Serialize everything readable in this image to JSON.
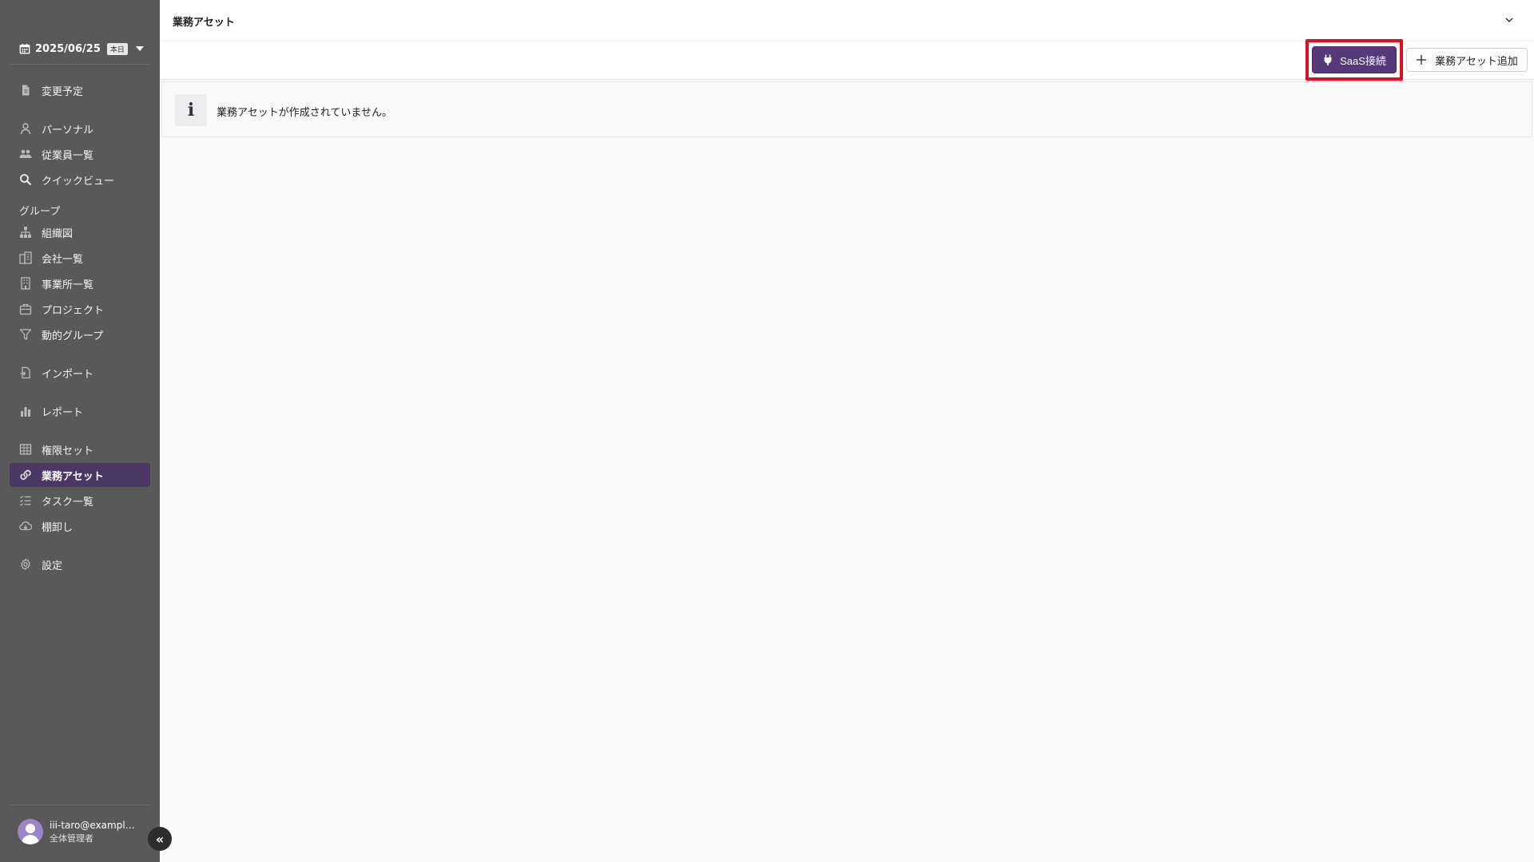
{
  "sidebar": {
    "date": "2025/06/25",
    "today_badge": "本日",
    "items": [
      {
        "label": "変更予定",
        "icon": "document-icon"
      },
      {
        "label": "パーソナル",
        "icon": "person-icon"
      },
      {
        "label": "従業員一覧",
        "icon": "people-icon"
      },
      {
        "label": "クイックビュー",
        "icon": "search-icon"
      },
      {
        "label": "組織図",
        "icon": "org-chart-icon"
      },
      {
        "label": "会社一覧",
        "icon": "buildings-icon"
      },
      {
        "label": "事業所一覧",
        "icon": "building-icon"
      },
      {
        "label": "プロジェクト",
        "icon": "briefcase-icon"
      },
      {
        "label": "動的グループ",
        "icon": "filter-icon"
      },
      {
        "label": "インポート",
        "icon": "import-icon"
      },
      {
        "label": "レポート",
        "icon": "bar-chart-icon"
      },
      {
        "label": "権限セット",
        "icon": "grid-icon"
      },
      {
        "label": "業務アセット",
        "icon": "link-icon",
        "active": true
      },
      {
        "label": "タスク一覧",
        "icon": "task-list-icon"
      },
      {
        "label": "棚卸し",
        "icon": "cloud-download-icon"
      },
      {
        "label": "設定",
        "icon": "gear-icon"
      }
    ],
    "group_label": "グループ",
    "user": {
      "email": "iii-taro@example.com",
      "role": "全体管理者"
    }
  },
  "header": {
    "title": "業務アセット"
  },
  "toolbar": {
    "saas_label": "SaaS接続",
    "add_label": "業務アセット追加"
  },
  "banner": {
    "message": "業務アセットが作成されていません。"
  },
  "colors": {
    "sidebar_bg": "#595959",
    "accent": "#55397a",
    "active_item": "#4a3763",
    "highlight": "#e10c24"
  }
}
